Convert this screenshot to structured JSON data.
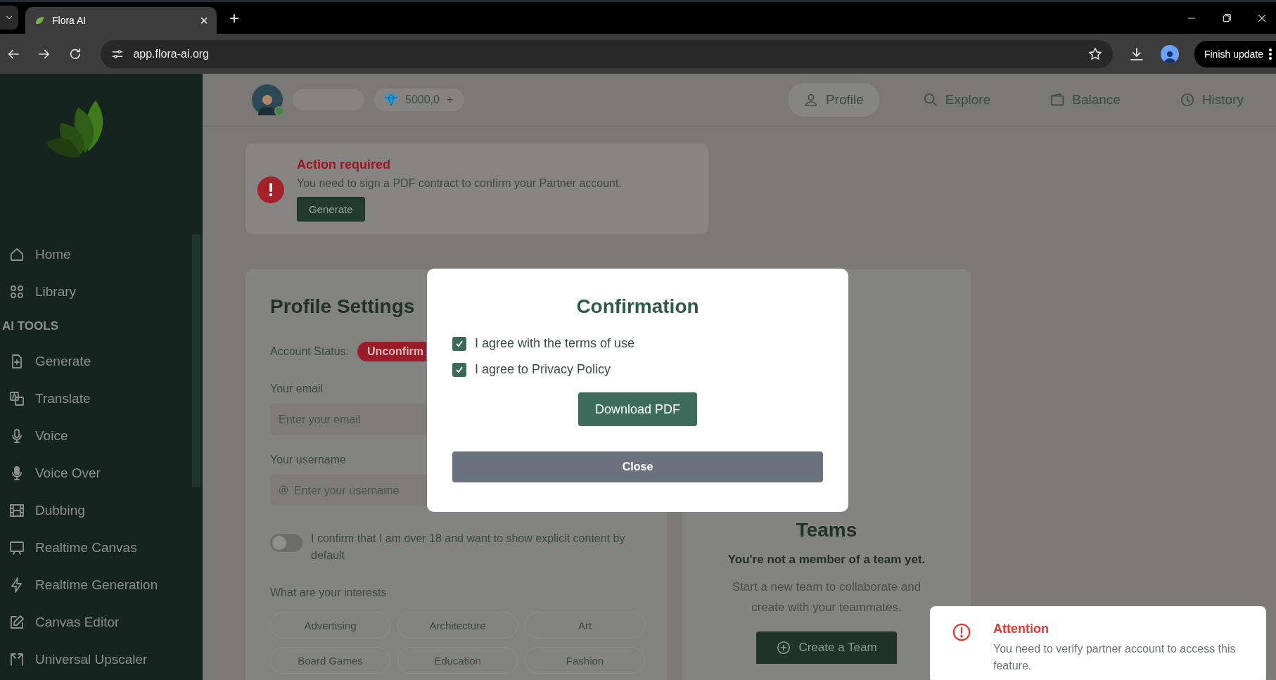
{
  "browser": {
    "tab": {
      "title": "Flora AI",
      "close": "×"
    },
    "new_tab": "+",
    "url": "app.flora-ai.org",
    "update_button": "Finish update"
  },
  "sidebar": {
    "items": [
      {
        "kind": "link",
        "label": "Home"
      },
      {
        "kind": "link",
        "label": "Library"
      },
      {
        "kind": "heading",
        "label": "AI TOOLS"
      },
      {
        "kind": "link",
        "label": "Generate"
      },
      {
        "kind": "link",
        "label": "Translate"
      },
      {
        "kind": "link",
        "label": "Voice"
      },
      {
        "kind": "link",
        "label": "Voice Over"
      },
      {
        "kind": "link",
        "label": "Dubbing"
      },
      {
        "kind": "link",
        "label": "Realtime Canvas"
      },
      {
        "kind": "link",
        "label": "Realtime Generation"
      },
      {
        "kind": "link",
        "label": "Canvas Editor"
      },
      {
        "kind": "link",
        "label": "Universal Upscaler"
      }
    ]
  },
  "header": {
    "credits": "5000,0",
    "add": "+",
    "nav": [
      {
        "label": "Profile",
        "selected": true
      },
      {
        "label": "Explore",
        "selected": false
      },
      {
        "label": "Balance",
        "selected": false
      },
      {
        "label": "History",
        "selected": false
      }
    ]
  },
  "action_card": {
    "title": "Action required",
    "message": "You need to sign a PDF contract to confirm your Partner account.",
    "button": "Generate"
  },
  "profile": {
    "title": "Profile Settings",
    "status_label": "Account Status:",
    "status": "Unconfirm",
    "email": {
      "label": "Your email",
      "placeholder": "Enter your email"
    },
    "username": {
      "label": "Your username",
      "placeholder": "Enter your username"
    },
    "explicit": {
      "label": "I confirm that I am over 18 and want to show explicit content by default",
      "on": false
    },
    "interests_label": "What are your interests",
    "interests": [
      {
        "label": "Advertising",
        "selected": false
      },
      {
        "label": "Architecture",
        "selected": false
      },
      {
        "label": "Art",
        "selected": false
      },
      {
        "label": "Board Games",
        "selected": false
      },
      {
        "label": "Education",
        "selected": false
      },
      {
        "label": "Fashion",
        "selected": false
      }
    ]
  },
  "teams": {
    "title": "Teams",
    "subtitle": "You're not a member of a team yet.",
    "description": "Start a new team to collaborate and create with your teammates.",
    "button": "Create a Team"
  },
  "modal": {
    "title": "Confirmation",
    "checks": [
      {
        "label": "I agree with the terms of use",
        "checked": true
      },
      {
        "label": "I agree to Privacy Policy",
        "checked": true
      }
    ],
    "download": "Download PDF",
    "close": "Close"
  },
  "toast": {
    "title": "Attention",
    "message": "You need to verify partner account to access this feature."
  }
}
